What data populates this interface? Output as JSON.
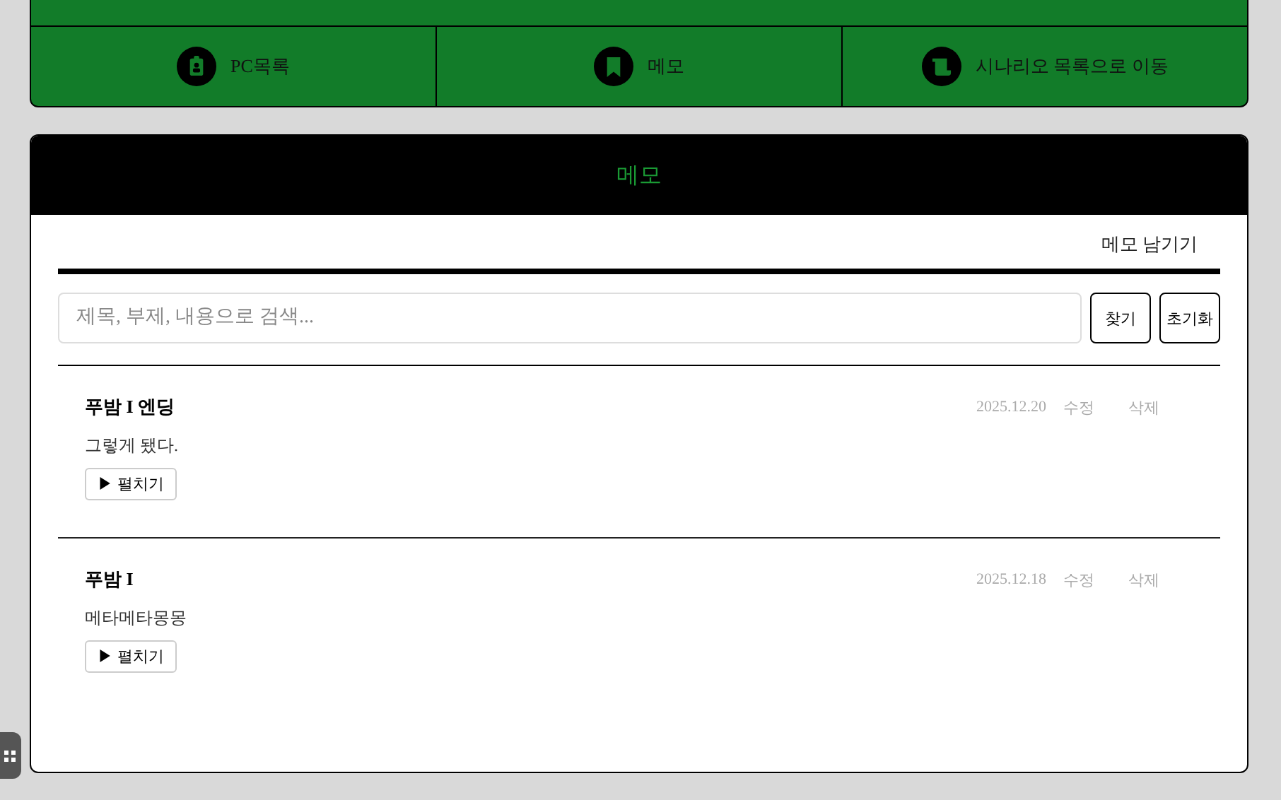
{
  "nav": [
    {
      "kind": "badge",
      "label": "PC목록"
    },
    {
      "kind": "bookmark",
      "label": "메모"
    },
    {
      "kind": "scroll",
      "label": "시나리오 목록으로 이동"
    }
  ],
  "memo_panel": {
    "title": "메모",
    "write_link": "메모 남기기",
    "search": {
      "placeholder": "제목, 부제, 내용으로 검색..."
    },
    "buttons": [
      "찾기",
      "초기화"
    ],
    "memos": [
      {
        "title": "푸밤 I 엔딩",
        "date": "2025.12.20",
        "edit": "수정",
        "delete": "삭제",
        "body": "그렇게 됐다.",
        "expand": "▶ 펼치기"
      },
      {
        "title": "푸밤 I",
        "date": "2025.12.18",
        "edit": "수정",
        "delete": "삭제",
        "body": "메타메타몽몽",
        "expand": "▶ 펼치기"
      }
    ]
  }
}
